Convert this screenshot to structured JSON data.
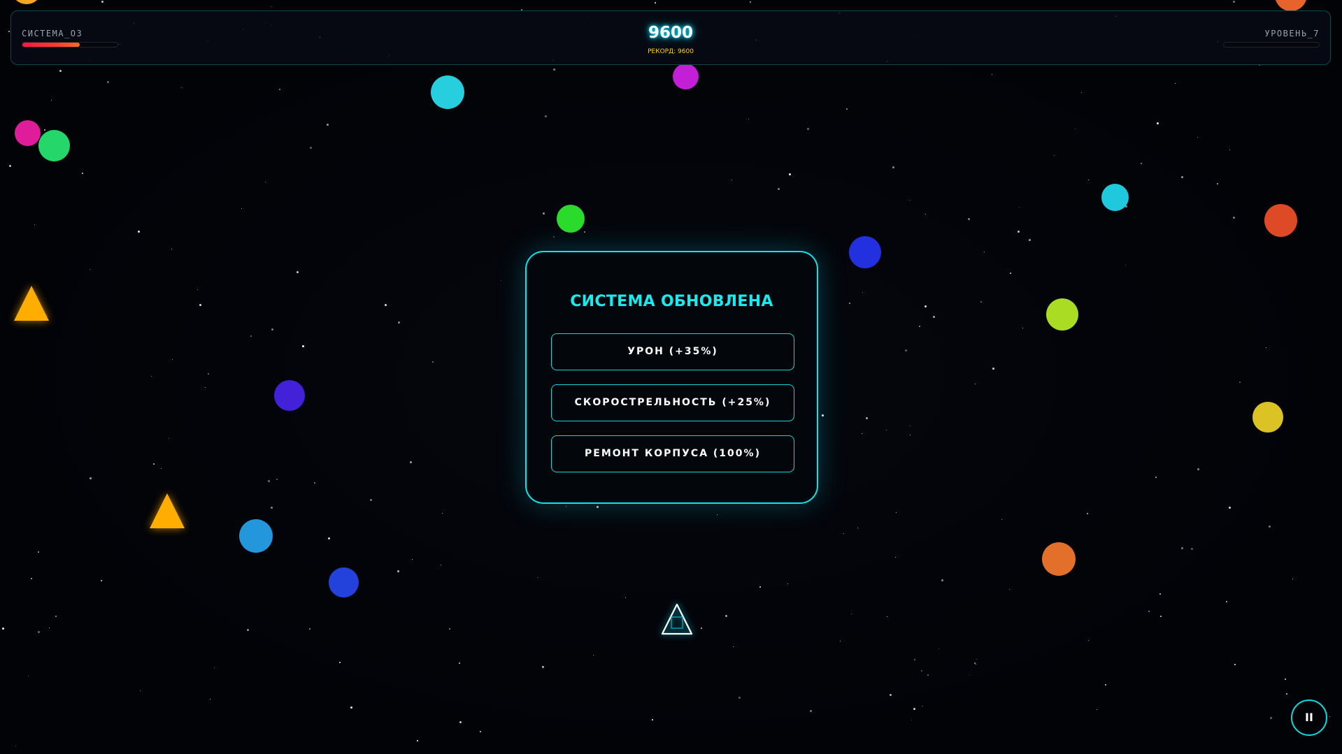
{
  "hud": {
    "hull_label": "СИСТЕМА_ОЗ",
    "hull_fraction": 0.6,
    "score": "9600",
    "record": "РЕКОРД: 9600",
    "level_label": "УРОВЕНЬ_7",
    "level_progress_fraction": 0.0
  },
  "modal": {
    "title": "СИСТЕМА ОБНОВЛЕНА",
    "options": [
      {
        "label": "УРОН (+35%)"
      },
      {
        "label": "СКОРОСТРЕЛЬНОСТЬ (+25%)"
      },
      {
        "label": "РЕМОНТ КОРПУСА (100%)"
      }
    ]
  },
  "pause_button": {
    "label": "II",
    "icon": "pause-icon"
  },
  "colors": {
    "accent": "#10e4e4",
    "score_glow": "#00e5ff",
    "record": "#ffd400",
    "hull_bar": "#ff1744",
    "enemy_triangle": "#ffae00"
  }
}
